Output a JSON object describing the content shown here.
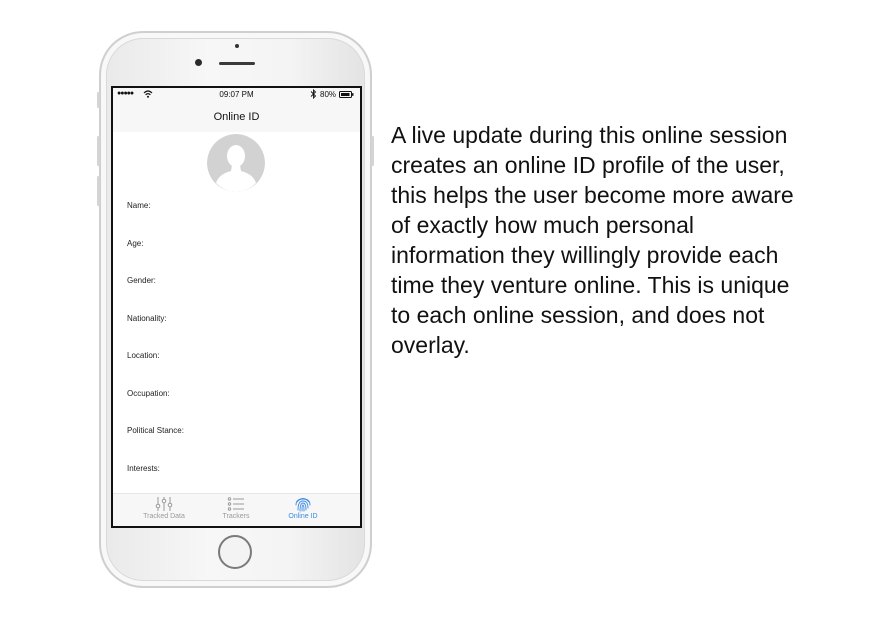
{
  "status_bar": {
    "signal": "●●●●●",
    "time": "09:07 PM",
    "battery": "80%"
  },
  "nav": {
    "title": "Online ID"
  },
  "profile": {
    "fields": [
      "Name:",
      "Age:",
      "Gender:",
      "Nationality:",
      "Location:",
      "Occupation:",
      "Political Stance:",
      "Interests:"
    ]
  },
  "tabs": [
    {
      "label": "Tracked Data",
      "icon": "sliders-icon"
    },
    {
      "label": "Trackers",
      "icon": "list-icon"
    },
    {
      "label": "Online ID",
      "icon": "fingerprint-icon",
      "active": true
    }
  ],
  "colors": {
    "accent": "#3d8be3",
    "inactive": "#9a9a9a"
  },
  "description": "A live update during this online session creates an online ID profile of the user, this helps the user become more aware of exactly how much personal information they willingly provide each time they venture online. This is unique to each online session, and does not overlay."
}
